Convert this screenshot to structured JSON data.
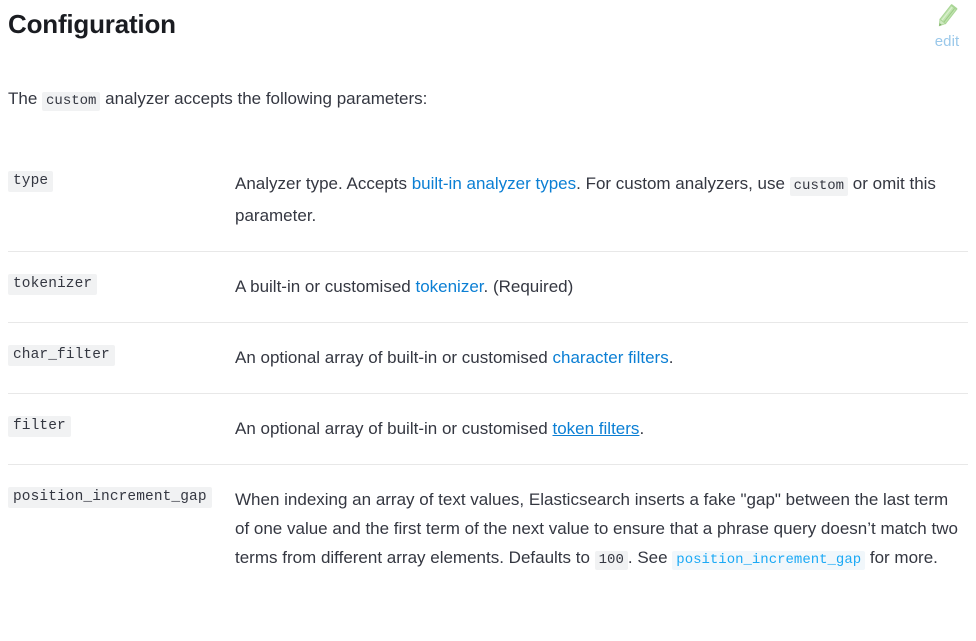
{
  "page": {
    "title": "Configuration",
    "edit": {
      "label": "edit",
      "icon": "pencil-icon",
      "icon_color": "#addda0",
      "label_color": "#9ac8ea"
    },
    "intro": {
      "before_code": "The ",
      "code": "custom",
      "after_code": " analyzer accepts the following parameters:"
    }
  },
  "colors": {
    "link": "#0b7fd4",
    "code_link": "#1ba9f5",
    "code_background": "#f1f2f3",
    "text": "#343741",
    "heading": "#1a1c21",
    "divider": "#e8e8e8"
  },
  "parameters": [
    {
      "term": "type",
      "parts": [
        {
          "type": "text",
          "value": "Analyzer type. Accepts "
        },
        {
          "type": "link",
          "value": "built-in analyzer types",
          "underlined": false
        },
        {
          "type": "text",
          "value": ". For custom analyzers, use "
        },
        {
          "type": "code",
          "value": "custom"
        },
        {
          "type": "text",
          "value": " or omit this parameter."
        }
      ]
    },
    {
      "term": "tokenizer",
      "parts": [
        {
          "type": "text",
          "value": "A built-in or customised "
        },
        {
          "type": "link",
          "value": "tokenizer",
          "underlined": false
        },
        {
          "type": "text",
          "value": ". (Required)"
        }
      ]
    },
    {
      "term": "char_filter",
      "parts": [
        {
          "type": "text",
          "value": "An optional array of built-in or customised "
        },
        {
          "type": "link",
          "value": "character filters",
          "underlined": false
        },
        {
          "type": "text",
          "value": "."
        }
      ]
    },
    {
      "term": "filter",
      "parts": [
        {
          "type": "text",
          "value": "An optional array of built-in or customised "
        },
        {
          "type": "link",
          "value": "token filters",
          "underlined": true
        },
        {
          "type": "text",
          "value": "."
        }
      ]
    },
    {
      "term": "position_increment_gap",
      "parts": [
        {
          "type": "text",
          "value": "When indexing an array of text values, Elasticsearch inserts a fake \"gap\" between the last term of one value and the first term of the next value to ensure that a phrase query doesn’t match two terms from different array elements. Defaults to "
        },
        {
          "type": "code",
          "value": "100"
        },
        {
          "type": "text",
          "value": ". See "
        },
        {
          "type": "code-link",
          "value": "position_increment_gap"
        },
        {
          "type": "text",
          "value": " for more."
        }
      ]
    }
  ]
}
